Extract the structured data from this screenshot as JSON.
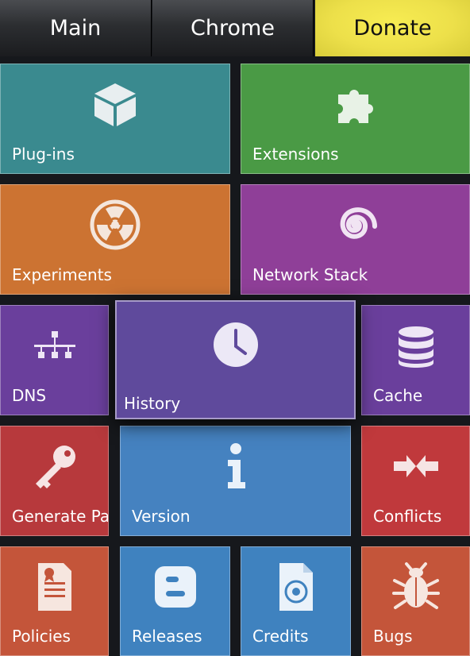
{
  "nav": {
    "main_label": "Main",
    "chrome_label": "Chrome",
    "donate_label": "Donate"
  },
  "tiles": {
    "plugins": {
      "label": "Plug-ins",
      "icon": "cube-icon",
      "color": "#3a8a8f"
    },
    "extensions": {
      "label": "Extensions",
      "icon": "puzzle-icon",
      "color": "#4a9a45"
    },
    "experiments": {
      "label": "Experiments",
      "icon": "radiation-icon",
      "color": "#cc7332"
    },
    "network_stack": {
      "label": "Network Stack",
      "icon": "spiral-icon",
      "color": "#8f3f98"
    },
    "dns": {
      "label": "DNS",
      "icon": "network-icon",
      "color": "#6a3f9c"
    },
    "history": {
      "label": "History",
      "icon": "clock-icon",
      "color": "#5f4a9c"
    },
    "cache": {
      "label": "Cache",
      "icon": "database-icon",
      "color": "#6a3f9c"
    },
    "generate_pa": {
      "label": "Generate Pa",
      "icon": "key-icon",
      "color": "#b7393c"
    },
    "version": {
      "label": "Version",
      "icon": "info-icon",
      "color": "#4582c0"
    },
    "conflicts": {
      "label": "Conflicts",
      "icon": "arrows-in-icon",
      "color": "#c0393c"
    },
    "policies": {
      "label": "Policies",
      "icon": "certificate-icon",
      "color": "#c4553a"
    },
    "releases": {
      "label": "Releases",
      "icon": "blogger-icon",
      "color": "#3f82bf"
    },
    "credits": {
      "label": "Credits",
      "icon": "chrome-file-icon",
      "color": "#3f82bf"
    },
    "bugs": {
      "label": "Bugs",
      "icon": "bug-icon",
      "color": "#c4553a"
    }
  }
}
